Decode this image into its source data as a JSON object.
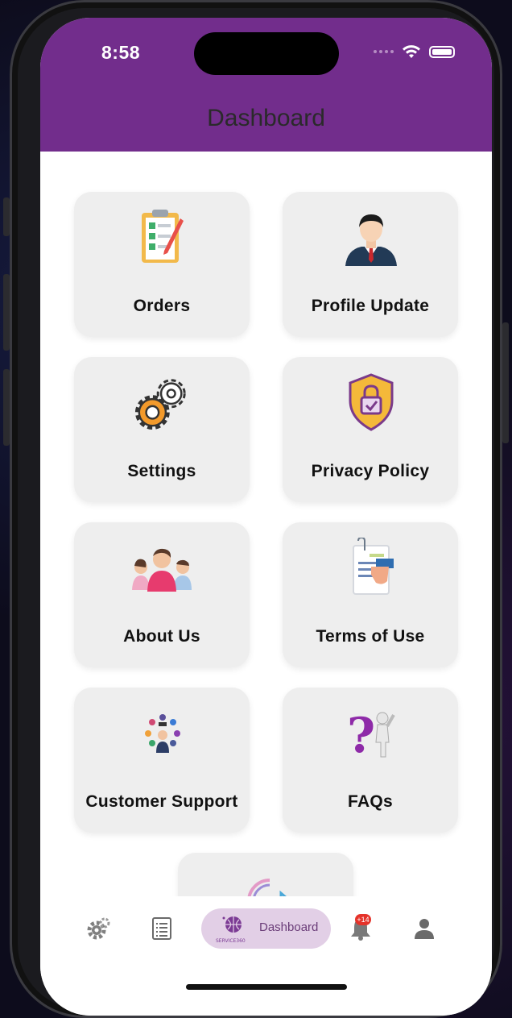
{
  "status_bar": {
    "time": "8:58"
  },
  "header": {
    "title": "Dashboard",
    "bg_color": "#722d8c"
  },
  "cards": [
    {
      "label": "Orders",
      "icon": "clipboard-checklist-icon"
    },
    {
      "label": "Profile Update",
      "icon": "businessman-avatar-icon"
    },
    {
      "label": "Settings",
      "icon": "gears-icon"
    },
    {
      "label": "Privacy Policy",
      "icon": "shield-lock-icon"
    },
    {
      "label": "About Us",
      "icon": "team-people-icon"
    },
    {
      "label": "Terms of Use",
      "icon": "document-hand-icon"
    },
    {
      "label": "Customer Support",
      "icon": "support-agent-icon"
    },
    {
      "label": "FAQs",
      "icon": "question-figure-icon"
    },
    {
      "label": "",
      "icon": "logout-arrow-icon"
    }
  ],
  "bottom_nav": {
    "items": [
      {
        "icon": "gear-icon"
      },
      {
        "icon": "document-list-icon"
      },
      {
        "icon": "service360-logo",
        "label": "Dashboard",
        "active": true
      },
      {
        "icon": "bell-icon",
        "badge": "+14"
      },
      {
        "icon": "person-icon"
      }
    ],
    "logo_text": "SERVICE360",
    "active_bg": "#e2cfe6"
  }
}
